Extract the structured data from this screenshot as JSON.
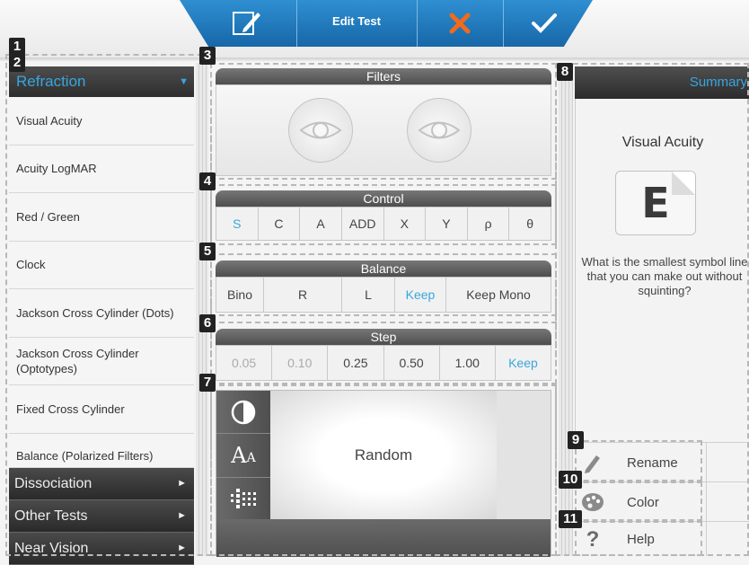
{
  "header": {
    "title": "Edit Test"
  },
  "colors": {
    "accent": "#36a6e0",
    "header_blue": "#1f79bd",
    "cancel": "#f26a1b"
  },
  "icons": {
    "edit": "edit-document-icon",
    "cancel": "cancel-x-icon",
    "confirm": "checkmark-icon"
  },
  "sidebar": {
    "section_title": "Refraction",
    "items": [
      {
        "label": "Visual Acuity"
      },
      {
        "label": "Acuity LogMAR"
      },
      {
        "label": "Red / Green"
      },
      {
        "label": "Clock"
      },
      {
        "label": "Jackson Cross Cylinder (Dots)"
      },
      {
        "label": "Jackson Cross Cylinder (Optotypes)"
      },
      {
        "label": "Fixed Cross Cylinder"
      },
      {
        "label": "Balance (Polarized Filters)"
      }
    ],
    "categories": [
      {
        "label": "Dissociation"
      },
      {
        "label": "Other Tests"
      },
      {
        "label": "Near Vision"
      }
    ]
  },
  "filters": {
    "title": "Filters"
  },
  "control": {
    "title": "Control",
    "buttons": [
      "S",
      "C",
      "A",
      "ADD",
      "X",
      "Y",
      "ρ",
      "θ"
    ],
    "active": "S"
  },
  "balance": {
    "title": "Balance",
    "buttons": [
      "Bino",
      "R",
      "L",
      "Keep",
      "Keep Mono"
    ],
    "active": "Keep"
  },
  "step": {
    "title": "Step",
    "buttons": [
      "0.05",
      "0.10",
      "0.25",
      "0.50",
      "1.00",
      "Keep"
    ],
    "active": "Keep",
    "disabled": [
      "0.05",
      "0.10"
    ]
  },
  "chart": {
    "label": "Random",
    "tools": [
      "contrast-icon",
      "font-size-icon",
      "grid-pattern-icon"
    ],
    "font_tool_label": "AA"
  },
  "summary": {
    "title": "Summary",
    "test_name": "Visual Acuity",
    "optotype": "E",
    "question": "What is the smallest symbol line that you can make out without squinting?"
  },
  "actions": [
    {
      "label": "Rename",
      "icon": "pencil-icon"
    },
    {
      "label": "Color",
      "icon": "palette-icon"
    },
    {
      "label": "Help",
      "icon": "question-icon"
    }
  ],
  "callouts": [
    "1",
    "2",
    "3",
    "4",
    "5",
    "6",
    "7",
    "8",
    "9",
    "10",
    "11"
  ]
}
